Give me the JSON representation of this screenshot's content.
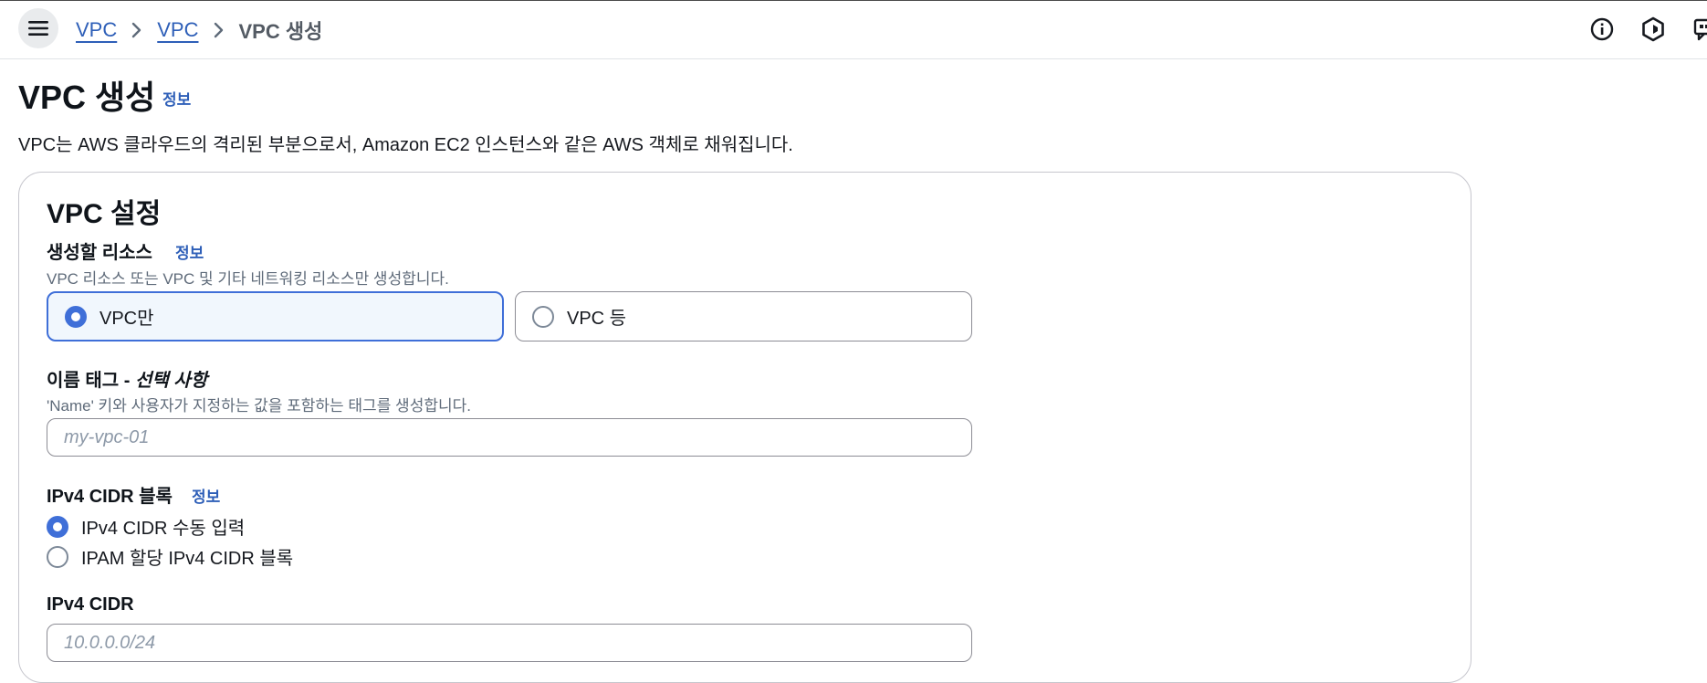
{
  "breadcrumb": {
    "items": [
      "VPC",
      "VPC"
    ],
    "current": "VPC 생성"
  },
  "icons": {
    "menu": "hamburger-menu-icon",
    "info": "info-circle-icon",
    "settings": "hexagon-settings-icon",
    "feedback": "feedback-icon"
  },
  "page": {
    "title": "VPC 생성",
    "info_label": "정보",
    "description": "VPC는 AWS 클라우드의 격리된 부분으로서, Amazon EC2 인스턴스와 같은 AWS 객체로 채워집니다."
  },
  "vpc_settings": {
    "title": "VPC 설정",
    "resources": {
      "label": "생성할 리소스",
      "info_label": "정보",
      "description": "VPC 리소스 또는 VPC 및 기타 네트워킹 리소스만 생성합니다.",
      "options": [
        "VPC만",
        "VPC 등"
      ],
      "selected": "VPC만"
    },
    "name_tag": {
      "label_main": "이름 태그 - ",
      "label_optional": "선택 사항",
      "description": "'Name' 키와 사용자가 지정하는 값을 포함하는 태그를 생성합니다.",
      "value": "",
      "placeholder": "my-vpc-01"
    },
    "ipv4_block": {
      "label": "IPv4 CIDR 블록",
      "info_label": "정보",
      "options": [
        "IPv4 CIDR 수동 입력",
        "IPAM 할당 IPv4 CIDR 블록"
      ],
      "selected": "IPv4 CIDR 수동 입력"
    },
    "ipv4_cidr": {
      "label": "IPv4 CIDR",
      "placeholder": "10.0.0.0/24"
    }
  },
  "colors": {
    "accent": "#3f6fd8",
    "link": "#2e5fb8",
    "selected_tile_bg": "#f1f7fd"
  }
}
